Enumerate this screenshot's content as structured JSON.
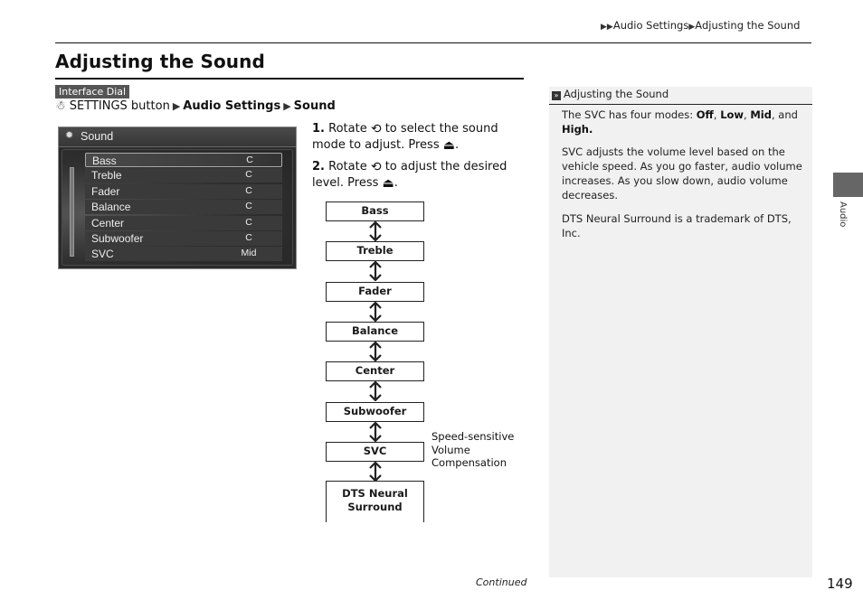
{
  "breadcrumb": {
    "items": [
      "Audio Settings",
      "Adjusting the Sound"
    ]
  },
  "page": {
    "title": "Adjusting the Sound",
    "number": "149",
    "continued": "Continued"
  },
  "nav": {
    "badge": "Interface Dial",
    "icon": "settings-button-icon",
    "path": [
      "SETTINGS button",
      "Audio Settings",
      "Sound"
    ]
  },
  "screen": {
    "title": "Sound",
    "header_icon": "gear-icon",
    "selected_index": 0,
    "rows": [
      {
        "label": "Bass",
        "value": "C"
      },
      {
        "label": "Treble",
        "value": "C"
      },
      {
        "label": "Fader",
        "value": "C"
      },
      {
        "label": "Balance",
        "value": "C"
      },
      {
        "label": "Center",
        "value": "C"
      },
      {
        "label": "Subwoofer",
        "value": "C"
      },
      {
        "label": "SVC",
        "value": "Mid"
      }
    ]
  },
  "steps": [
    {
      "num": "1.",
      "a": "Rotate",
      "icon1": "rotate-dial-icon",
      "b": "to select the sound mode to adjust. Press",
      "icon2": "press-dial-icon",
      "c": "."
    },
    {
      "num": "2.",
      "a": "Rotate",
      "icon1": "rotate-dial-icon",
      "b": "to adjust the desired level. Press",
      "icon2": "press-dial-icon",
      "c": "."
    }
  ],
  "flow": {
    "boxes": [
      "Bass",
      "Treble",
      "Fader",
      "Balance",
      "Center",
      "Subwoofer",
      "SVC"
    ],
    "last_box": [
      "DTS Neural",
      "Surround"
    ],
    "svc_note": [
      "Speed-sensitive",
      "Volume",
      "Compensation"
    ]
  },
  "side": {
    "heading": "Adjusting the Sound",
    "p1_prefix": "The SVC has four modes: ",
    "modes": [
      "Off",
      "Low",
      "Mid",
      "High."
    ],
    "p2": "SVC adjusts the volume level based on the vehicle speed. As you go faster, audio volume increases. As you slow down, audio volume decreases.",
    "p3": "DTS Neural Surround is a trademark of DTS, Inc.",
    "tab_label": "Audio"
  }
}
